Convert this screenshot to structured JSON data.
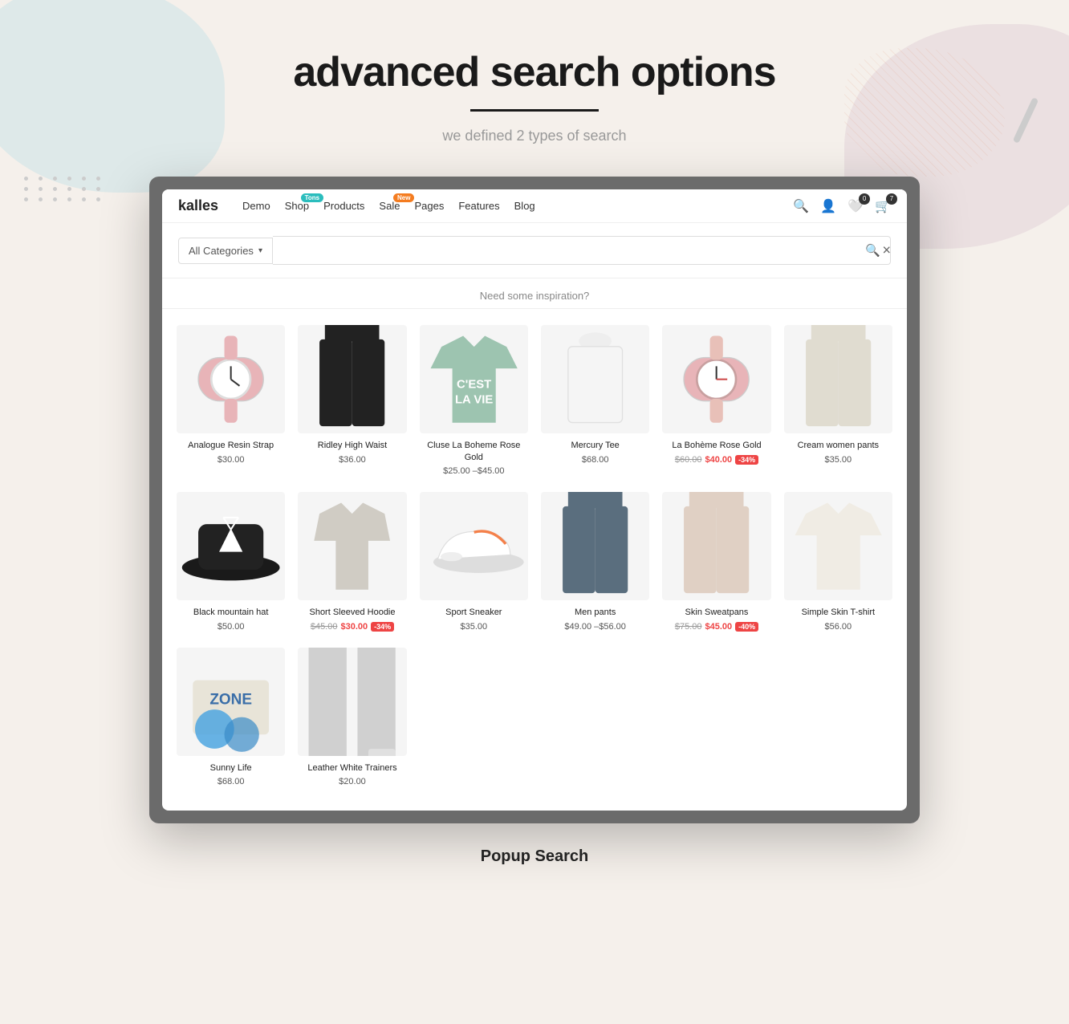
{
  "page": {
    "title": "advanced search  options",
    "title_underline": true,
    "subtitle": "we defined 2 types of search",
    "footer_label": "Popup Search"
  },
  "navbar": {
    "logo": "kalles",
    "links": [
      {
        "label": "Demo",
        "badge": null
      },
      {
        "label": "Shop",
        "badge": {
          "text": "Tons",
          "type": "teal"
        }
      },
      {
        "label": "Products",
        "badge": null
      },
      {
        "label": "Sale",
        "badge": {
          "text": "New",
          "type": "orange"
        }
      },
      {
        "label": "Pages",
        "badge": null
      },
      {
        "label": "Features",
        "badge": null
      },
      {
        "label": "Blog",
        "badge": null
      }
    ],
    "icons": [
      {
        "name": "search",
        "symbol": "🔍",
        "count": null
      },
      {
        "name": "user",
        "symbol": "👤",
        "count": null
      },
      {
        "name": "wishlist",
        "symbol": "🤍",
        "count": "0"
      },
      {
        "name": "cart",
        "symbol": "🛒",
        "count": "7"
      }
    ]
  },
  "search": {
    "category_label": "All Categories",
    "placeholder": "",
    "close_label": "×"
  },
  "inspiration": {
    "label": "Need some inspiration?"
  },
  "products": [
    {
      "name": "Analogue Resin Strap",
      "price": "$30.00",
      "price_original": null,
      "price_sale": null,
      "sale_pct": null,
      "color": "#e8d5c0",
      "img_type": "watch_pink"
    },
    {
      "name": "Ridley High Waist",
      "price": "$36.00",
      "price_original": null,
      "price_sale": null,
      "sale_pct": null,
      "color": "#d8d8d8",
      "img_type": "pants_black"
    },
    {
      "name": "Cluse La Boheme Rose Gold",
      "price_original": "$25.00",
      "price_sale": "$45.00",
      "sale_pct": null,
      "color": "#b5c9b5",
      "img_type": "tshirt_green"
    },
    {
      "name": "Mercury Tee",
      "price": "$68.00",
      "price_original": null,
      "price_sale": null,
      "sale_pct": null,
      "color": "#e8e8e4",
      "img_type": "top_white"
    },
    {
      "name": "La Bohème Rose Gold",
      "price": "$40.00",
      "price_original": "$60.00",
      "price_sale": "$40.00",
      "sale_pct": "-34%",
      "color": "#f0e8e0",
      "img_type": "watch_rose"
    },
    {
      "name": "Cream women pants",
      "price": "$35.00",
      "price_original": null,
      "price_sale": null,
      "sale_pct": null,
      "color": "#e8e4dc",
      "img_type": "pants_cream"
    },
    {
      "name": "Black mountain hat",
      "price": "$50.00",
      "price_original": null,
      "price_sale": null,
      "sale_pct": null,
      "color": "#222",
      "img_type": "hat_black"
    },
    {
      "name": "Short Sleeved Hoodie",
      "price": "$30.00",
      "price_original": "$45.00",
      "price_sale": "$30.00",
      "sale_pct": "-34%",
      "color": "#d8d4cc",
      "img_type": "hoodie_grey"
    },
    {
      "name": "Sport Sneaker",
      "price": "$35.00",
      "price_original": null,
      "price_sale": null,
      "sale_pct": null,
      "color": "#f0f0f0",
      "img_type": "sneaker_white"
    },
    {
      "name": "Men pants",
      "price_original": "$49.00",
      "price_sale": "$56.00",
      "sale_pct": null,
      "price": "$49.00 –$56.00",
      "color": "#6b7c8c",
      "img_type": "pants_blue"
    },
    {
      "name": "Skin Sweatpans",
      "price": "$45.00",
      "price_original": "$75.00",
      "price_sale": "$45.00",
      "sale_pct": "-40%",
      "color": "#e8dcd4",
      "img_type": "pants_skin"
    },
    {
      "name": "Simple Skin T-shirt",
      "price": "$56.00",
      "price_original": null,
      "price_sale": null,
      "sale_pct": null,
      "color": "#f0ece4",
      "img_type": "tshirt_cream"
    },
    {
      "name": "Sunny Life",
      "price": "$68.00",
      "price_original": null,
      "price_sale": null,
      "sale_pct": null,
      "color": "#e8f0f8",
      "img_type": "box_blue"
    },
    {
      "name": "Leather White Trainers",
      "price": "$20.00",
      "price_original": null,
      "price_sale": null,
      "sale_pct": null,
      "color": "#e0e0e0",
      "img_type": "pants_grey"
    }
  ]
}
